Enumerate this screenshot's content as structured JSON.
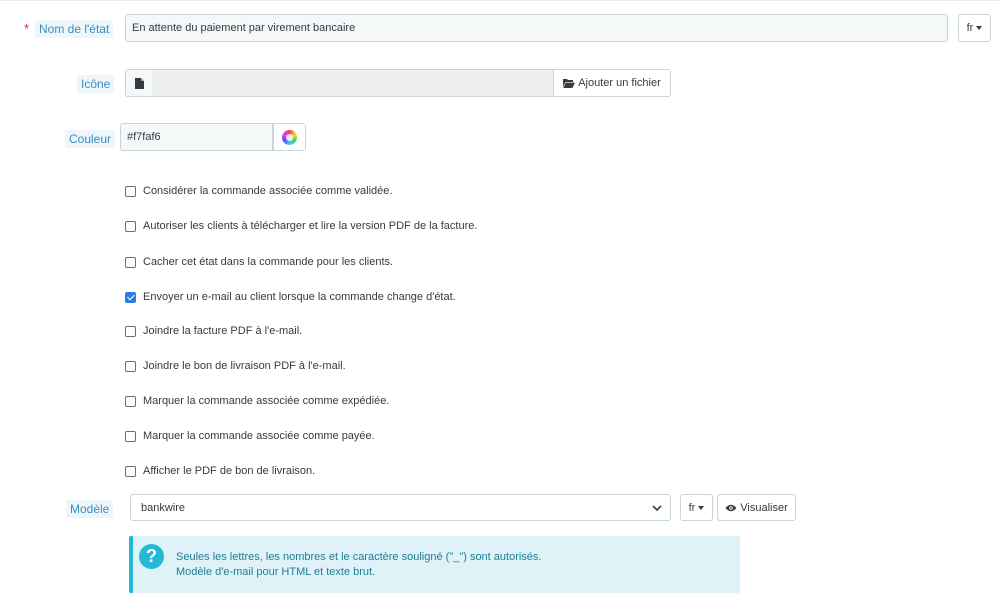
{
  "name_field": {
    "required_mark": "*",
    "label": "Nom de l'état",
    "value": "En attente du paiement par virement bancaire",
    "lang": "fr"
  },
  "icon_field": {
    "label": "Icône",
    "file_icon": "file-icon",
    "upload_icon": "folder-open-icon",
    "upload_label": "Ajouter un fichier"
  },
  "color_field": {
    "label": "Couleur",
    "value": "#f7faf6",
    "picker_icon": "color-wheel-icon"
  },
  "checkboxes": [
    {
      "label": "Considérer la commande associée comme validée.",
      "checked": false
    },
    {
      "label": "Autoriser les clients à télécharger et lire la version PDF de la facture.",
      "checked": false
    },
    {
      "label": "Cacher cet état dans la commande pour les clients.",
      "checked": false
    },
    {
      "label": "Envoyer un e-mail au client lorsque la commande change d'état.",
      "checked": true
    },
    {
      "label": "Joindre la facture PDF à l'e-mail.",
      "checked": false
    },
    {
      "label": "Joindre le bon de livraison PDF à l'e-mail.",
      "checked": false
    },
    {
      "label": "Marquer la commande associée comme expédiée.",
      "checked": false
    },
    {
      "label": "Marquer la commande associée comme payée.",
      "checked": false
    },
    {
      "label": "Afficher le PDF de bon de livraison.",
      "checked": false
    }
  ],
  "template_field": {
    "label": "Modèle",
    "selected": "bankwire",
    "lang": "fr",
    "preview_icon": "eye-icon",
    "preview_label": "Visualiser"
  },
  "help": {
    "icon": "question-circle-icon",
    "line1": "Seules les lettres, les nombres et le caractère souligné (\"_\") sont autorisés.",
    "line2": "Modèle d'e-mail pour HTML et texte brut."
  },
  "colors": {
    "accent": "#25b9d7",
    "label_text": "#3a8dbd",
    "checkbox_checked": "#2c7be5",
    "required": "#e0242e"
  }
}
